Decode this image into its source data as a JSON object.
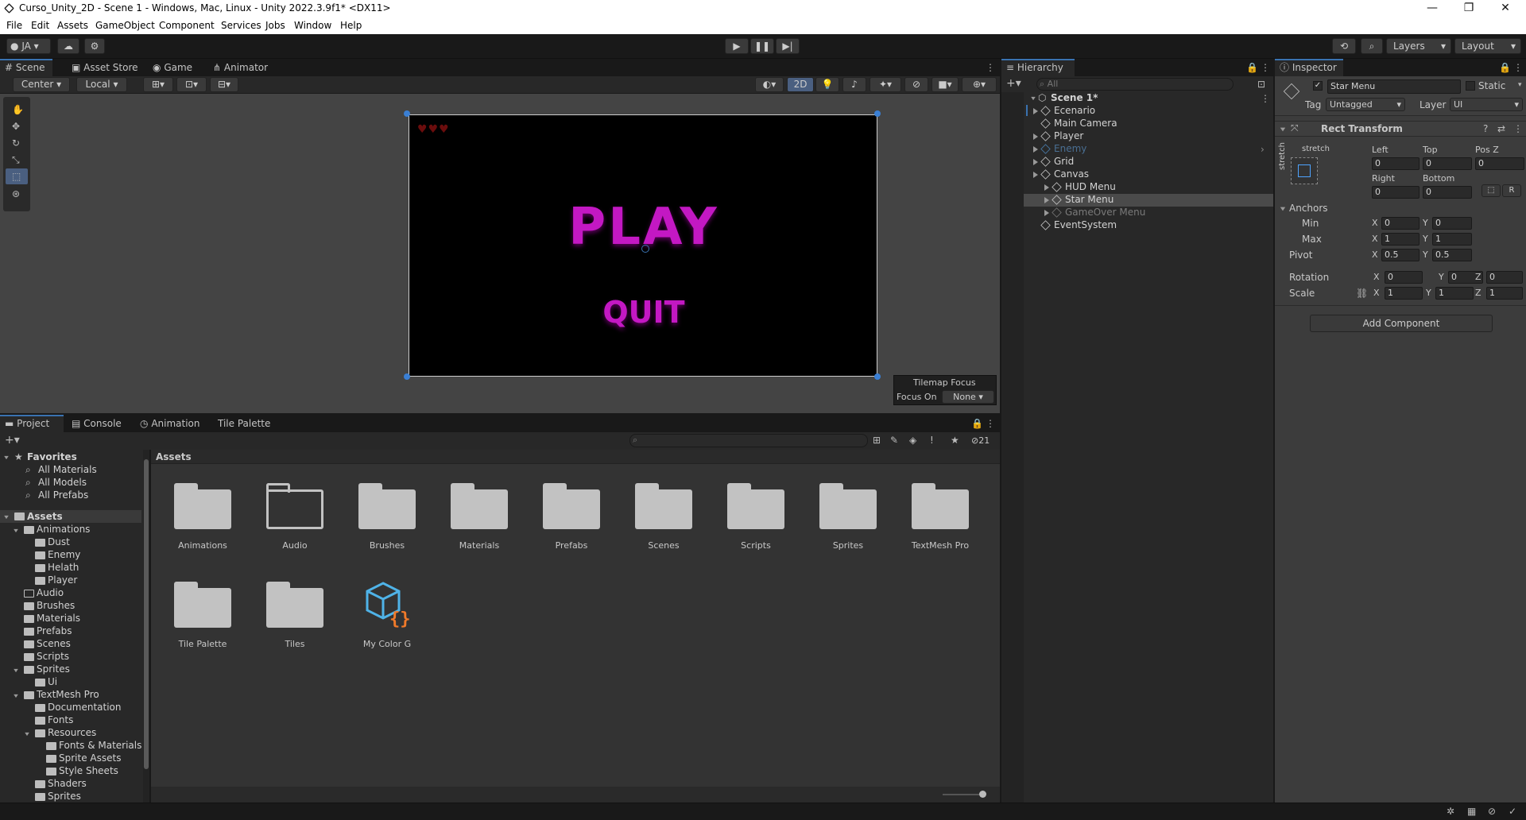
{
  "window": {
    "title": "Curso_Unity_2D - Scene 1 - Windows, Mac, Linux - Unity 2022.3.9f1* <DX11>",
    "controls": [
      "—",
      "❐",
      "✕"
    ]
  },
  "menu": [
    "File",
    "Edit",
    "Assets",
    "GameObject",
    "Component",
    "Services",
    "Jobs",
    "Window",
    "Help"
  ],
  "toolbar": {
    "account": "JA",
    "layers": "Layers",
    "layout": "Layout"
  },
  "scene_tabs": [
    "Scene",
    "Asset Store",
    "Game",
    "Animator"
  ],
  "scene_tools": {
    "pivot": "Center",
    "space": "Local",
    "mode_2d": "2D"
  },
  "game_view": {
    "play_text": "PLAY",
    "quit_text": "QUIT",
    "hearts": 3
  },
  "tilemap_focus": {
    "title": "Tilemap Focus",
    "label": "Focus On",
    "value": "None"
  },
  "hierarchy": {
    "title": "Hierarchy",
    "search_placeholder": "All",
    "scene": "Scene 1*",
    "items": [
      {
        "label": "Ecenario",
        "depth": 1,
        "expandable": true,
        "state": "normal"
      },
      {
        "label": "Main Camera",
        "depth": 1,
        "expandable": false,
        "state": "normal"
      },
      {
        "label": "Player",
        "depth": 1,
        "expandable": true,
        "state": "normal"
      },
      {
        "label": "Enemy",
        "depth": 1,
        "expandable": true,
        "state": "prefab-dim"
      },
      {
        "label": "Grid",
        "depth": 1,
        "expandable": true,
        "state": "normal"
      },
      {
        "label": "Canvas",
        "depth": 1,
        "expandable": true,
        "state": "normal"
      },
      {
        "label": "HUD Menu",
        "depth": 2,
        "expandable": true,
        "state": "normal"
      },
      {
        "label": "Star Menu",
        "depth": 2,
        "expandable": true,
        "state": "selected"
      },
      {
        "label": "GameOver Menu",
        "depth": 2,
        "expandable": true,
        "state": "disabled"
      },
      {
        "label": "EventSystem",
        "depth": 1,
        "expandable": false,
        "state": "normal"
      }
    ]
  },
  "inspector": {
    "title": "Inspector",
    "object_name": "Star Menu",
    "static_label": "Static",
    "tag_label": "Tag",
    "tag_value": "Untagged",
    "layer_label": "Layer",
    "layer_value": "UI",
    "component": "Rect Transform",
    "stretch_label": "stretch",
    "left_label": "Left",
    "left": "0",
    "top_label": "Top",
    "top": "0",
    "posz_label": "Pos Z",
    "posz": "0",
    "right_label": "Right",
    "right": "0",
    "bottom_label": "Bottom",
    "bottom": "0",
    "anchors_label": "Anchors",
    "min_label": "Min",
    "min_x": "0",
    "min_y": "0",
    "max_label": "Max",
    "max_x": "1",
    "max_y": "1",
    "pivot_label": "Pivot",
    "pivot_x": "0.5",
    "pivot_y": "0.5",
    "rotation_label": "Rotation",
    "rot_x": "0",
    "rot_y": "0",
    "rot_z": "0",
    "scale_label": "Scale",
    "scale_x": "1",
    "scale_y": "1",
    "scale_z": "1",
    "x_label": "X",
    "y_label": "Y",
    "z_label": "Z",
    "r_label": "R",
    "add_component": "Add Component"
  },
  "bottom_tabs": [
    "Project",
    "Console",
    "Animation",
    "Tile Palette"
  ],
  "project": {
    "hidden_count": "21",
    "favorites_label": "Favorites",
    "favorites": [
      "All Materials",
      "All Models",
      "All Prefabs"
    ],
    "assets_label": "Assets",
    "tree": [
      {
        "label": "Animations",
        "depth": 1,
        "open": true
      },
      {
        "label": "Dust",
        "depth": 2
      },
      {
        "label": "Enemy",
        "depth": 2
      },
      {
        "label": "Helath",
        "depth": 2
      },
      {
        "label": "Player",
        "depth": 2
      },
      {
        "label": "Audio",
        "depth": 1,
        "empty": true
      },
      {
        "label": "Brushes",
        "depth": 1
      },
      {
        "label": "Materials",
        "depth": 1
      },
      {
        "label": "Prefabs",
        "depth": 1
      },
      {
        "label": "Scenes",
        "depth": 1
      },
      {
        "label": "Scripts",
        "depth": 1
      },
      {
        "label": "Sprites",
        "depth": 1,
        "open": true
      },
      {
        "label": "Ui",
        "depth": 2
      },
      {
        "label": "TextMesh Pro",
        "depth": 1,
        "open": true
      },
      {
        "label": "Documentation",
        "depth": 2
      },
      {
        "label": "Fonts",
        "depth": 2
      },
      {
        "label": "Resources",
        "depth": 2,
        "open": true
      },
      {
        "label": "Fonts & Materials",
        "depth": 3
      },
      {
        "label": "Sprite Assets",
        "depth": 3
      },
      {
        "label": "Style Sheets",
        "depth": 3
      },
      {
        "label": "Shaders",
        "depth": 2
      },
      {
        "label": "Sprites",
        "depth": 2
      }
    ],
    "breadcrumb": "Assets",
    "grid": [
      {
        "label": "Animations",
        "type": "folder"
      },
      {
        "label": "Audio",
        "type": "empty-folder"
      },
      {
        "label": "Brushes",
        "type": "folder"
      },
      {
        "label": "Materials",
        "type": "folder"
      },
      {
        "label": "Prefabs",
        "type": "folder"
      },
      {
        "label": "Scenes",
        "type": "folder"
      },
      {
        "label": "Scripts",
        "type": "folder"
      },
      {
        "label": "Sprites",
        "type": "folder"
      },
      {
        "label": "TextMesh Pro",
        "type": "folder"
      },
      {
        "label": "Tile Palette",
        "type": "folder"
      },
      {
        "label": "Tiles",
        "type": "folder"
      },
      {
        "label": "My Color G",
        "type": "script-asset"
      }
    ]
  },
  "colors": {
    "accent": "#3a72b0",
    "play_text": "#c318c3",
    "selected_row": "#4a4a4a"
  }
}
